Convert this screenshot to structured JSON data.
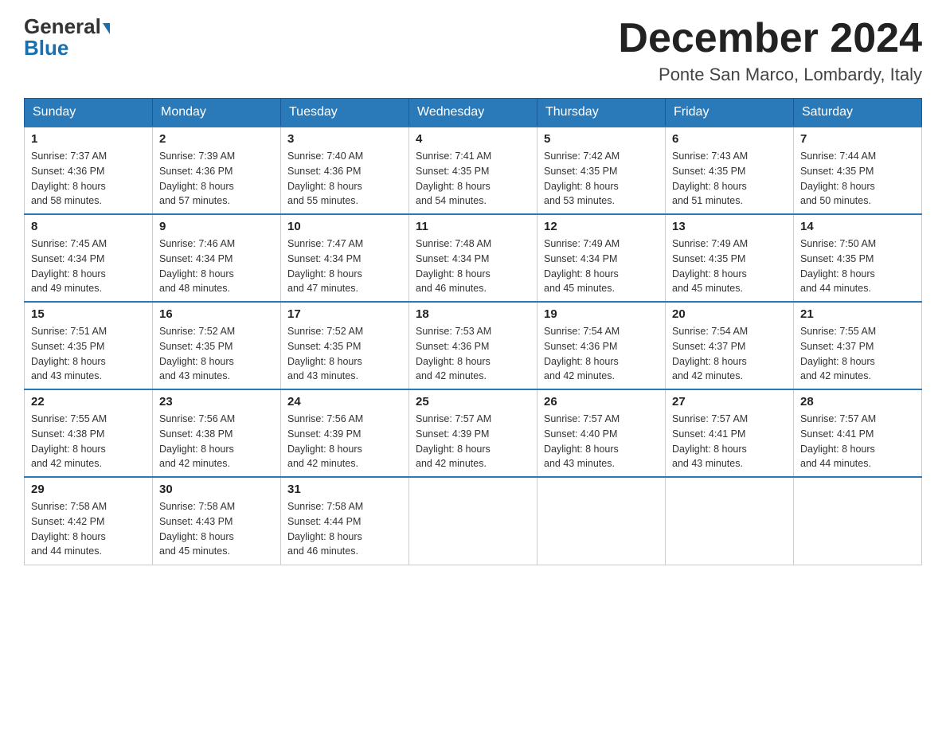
{
  "logo": {
    "general": "General",
    "blue": "Blue"
  },
  "title": "December 2024",
  "subtitle": "Ponte San Marco, Lombardy, Italy",
  "days_of_week": [
    "Sunday",
    "Monday",
    "Tuesday",
    "Wednesday",
    "Thursday",
    "Friday",
    "Saturday"
  ],
  "weeks": [
    [
      {
        "day": "1",
        "sunrise": "7:37 AM",
        "sunset": "4:36 PM",
        "daylight": "8 hours and 58 minutes."
      },
      {
        "day": "2",
        "sunrise": "7:39 AM",
        "sunset": "4:36 PM",
        "daylight": "8 hours and 57 minutes."
      },
      {
        "day": "3",
        "sunrise": "7:40 AM",
        "sunset": "4:36 PM",
        "daylight": "8 hours and 55 minutes."
      },
      {
        "day": "4",
        "sunrise": "7:41 AM",
        "sunset": "4:35 PM",
        "daylight": "8 hours and 54 minutes."
      },
      {
        "day": "5",
        "sunrise": "7:42 AM",
        "sunset": "4:35 PM",
        "daylight": "8 hours and 53 minutes."
      },
      {
        "day": "6",
        "sunrise": "7:43 AM",
        "sunset": "4:35 PM",
        "daylight": "8 hours and 51 minutes."
      },
      {
        "day": "7",
        "sunrise": "7:44 AM",
        "sunset": "4:35 PM",
        "daylight": "8 hours and 50 minutes."
      }
    ],
    [
      {
        "day": "8",
        "sunrise": "7:45 AM",
        "sunset": "4:34 PM",
        "daylight": "8 hours and 49 minutes."
      },
      {
        "day": "9",
        "sunrise": "7:46 AM",
        "sunset": "4:34 PM",
        "daylight": "8 hours and 48 minutes."
      },
      {
        "day": "10",
        "sunrise": "7:47 AM",
        "sunset": "4:34 PM",
        "daylight": "8 hours and 47 minutes."
      },
      {
        "day": "11",
        "sunrise": "7:48 AM",
        "sunset": "4:34 PM",
        "daylight": "8 hours and 46 minutes."
      },
      {
        "day": "12",
        "sunrise": "7:49 AM",
        "sunset": "4:34 PM",
        "daylight": "8 hours and 45 minutes."
      },
      {
        "day": "13",
        "sunrise": "7:49 AM",
        "sunset": "4:35 PM",
        "daylight": "8 hours and 45 minutes."
      },
      {
        "day": "14",
        "sunrise": "7:50 AM",
        "sunset": "4:35 PM",
        "daylight": "8 hours and 44 minutes."
      }
    ],
    [
      {
        "day": "15",
        "sunrise": "7:51 AM",
        "sunset": "4:35 PM",
        "daylight": "8 hours and 43 minutes."
      },
      {
        "day": "16",
        "sunrise": "7:52 AM",
        "sunset": "4:35 PM",
        "daylight": "8 hours and 43 minutes."
      },
      {
        "day": "17",
        "sunrise": "7:52 AM",
        "sunset": "4:35 PM",
        "daylight": "8 hours and 43 minutes."
      },
      {
        "day": "18",
        "sunrise": "7:53 AM",
        "sunset": "4:36 PM",
        "daylight": "8 hours and 42 minutes."
      },
      {
        "day": "19",
        "sunrise": "7:54 AM",
        "sunset": "4:36 PM",
        "daylight": "8 hours and 42 minutes."
      },
      {
        "day": "20",
        "sunrise": "7:54 AM",
        "sunset": "4:37 PM",
        "daylight": "8 hours and 42 minutes."
      },
      {
        "day": "21",
        "sunrise": "7:55 AM",
        "sunset": "4:37 PM",
        "daylight": "8 hours and 42 minutes."
      }
    ],
    [
      {
        "day": "22",
        "sunrise": "7:55 AM",
        "sunset": "4:38 PM",
        "daylight": "8 hours and 42 minutes."
      },
      {
        "day": "23",
        "sunrise": "7:56 AM",
        "sunset": "4:38 PM",
        "daylight": "8 hours and 42 minutes."
      },
      {
        "day": "24",
        "sunrise": "7:56 AM",
        "sunset": "4:39 PM",
        "daylight": "8 hours and 42 minutes."
      },
      {
        "day": "25",
        "sunrise": "7:57 AM",
        "sunset": "4:39 PM",
        "daylight": "8 hours and 42 minutes."
      },
      {
        "day": "26",
        "sunrise": "7:57 AM",
        "sunset": "4:40 PM",
        "daylight": "8 hours and 43 minutes."
      },
      {
        "day": "27",
        "sunrise": "7:57 AM",
        "sunset": "4:41 PM",
        "daylight": "8 hours and 43 minutes."
      },
      {
        "day": "28",
        "sunrise": "7:57 AM",
        "sunset": "4:41 PM",
        "daylight": "8 hours and 44 minutes."
      }
    ],
    [
      {
        "day": "29",
        "sunrise": "7:58 AM",
        "sunset": "4:42 PM",
        "daylight": "8 hours and 44 minutes."
      },
      {
        "day": "30",
        "sunrise": "7:58 AM",
        "sunset": "4:43 PM",
        "daylight": "8 hours and 45 minutes."
      },
      {
        "day": "31",
        "sunrise": "7:58 AM",
        "sunset": "4:44 PM",
        "daylight": "8 hours and 46 minutes."
      },
      null,
      null,
      null,
      null
    ]
  ],
  "labels": {
    "sunrise": "Sunrise: ",
    "sunset": "Sunset: ",
    "daylight": "Daylight: "
  }
}
